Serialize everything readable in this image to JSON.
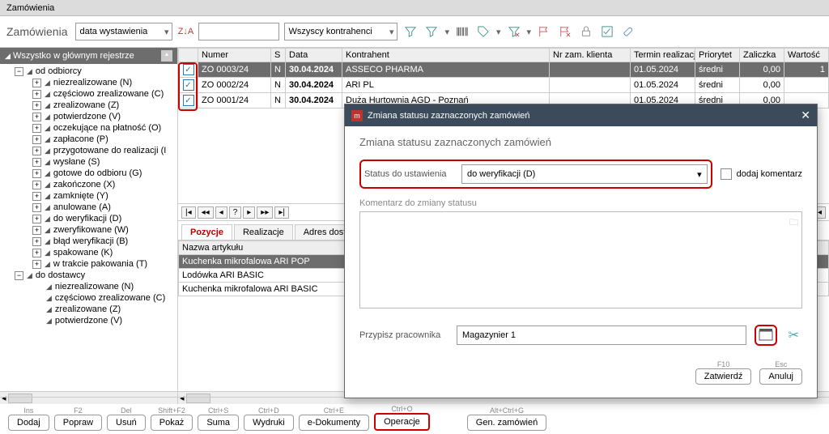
{
  "titlebar": "Zamówienia",
  "top": {
    "title": "Zamówienia",
    "dateCombo": "data wystawienia",
    "kontrahenciCombo": "Wszyscy kontrahenci"
  },
  "treeHeader": "Wszystko w głównym rejestrze",
  "tree": {
    "root1": "od odbiorcy",
    "items1": [
      "niezrealizowane (N)",
      "częściowo zrealizowane (C)",
      "zrealizowane (Z)",
      "potwierdzone (V)",
      "oczekujące na płatność (O)",
      "zapłacone (P)",
      "przygotowane do realizacji (I",
      "wysłane (S)",
      "gotowe do odbioru (G)",
      "zakończone (X)",
      "zamknięte (Y)",
      "anulowane  (A)",
      "do weryfikacji (D)",
      "zweryfikowane (W)",
      "błąd weryfikacji (B)",
      "spakowane (K)",
      "w trakcie pakowania (T)"
    ],
    "root2": "do dostawcy",
    "items2": [
      "niezrealizowane (N)",
      "częściowo zrealizowane (C)",
      "zrealizowane (Z)",
      "potwierdzone (V)"
    ]
  },
  "gridHeaders": [
    "",
    "Numer",
    "S",
    "Data",
    "Kontrahent",
    "Nr zam. klienta",
    "Termin realizacji",
    "Priorytet",
    "Zaliczka",
    "Wartość"
  ],
  "rows": [
    {
      "num": "ZO 0003/24",
      "s": "N",
      "date": "30.04.2024",
      "k": "ASSECO PHARMA",
      "nz": "",
      "term": "01.05.2024",
      "prio": "średni",
      "zal": "0,00",
      "wart": "1"
    },
    {
      "num": "ZO 0002/24",
      "s": "N",
      "date": "30.04.2024",
      "k": "ARI PL",
      "nz": "",
      "term": "01.05.2024",
      "prio": "średni",
      "zal": "0,00",
      "wart": ""
    },
    {
      "num": "ZO 0001/24",
      "s": "N",
      "date": "30.04.2024",
      "k": "Duża Hurtownia AGD - Poznań",
      "nz": "",
      "term": "01.05.2024",
      "prio": "średni",
      "zal": "0,00",
      "wart": ""
    }
  ],
  "tabs": {
    "pozycje": "Pozycje",
    "realizacje": "Realizacje",
    "adres": "Adres dostawy"
  },
  "detailHeader": "Nazwa artykułu",
  "detailRows": [
    "Kuchenka mikrofalowa ARI POP",
    "Lodówka ARI BASIC",
    "Kuchenka mikrofalowa ARI BASIC"
  ],
  "modal": {
    "title": "Zmiana statusu zaznaczonych zamówień",
    "heading": "Zmiana statusu zaznaczonych zamówień",
    "statusLabel": "Status do ustawienia",
    "statusValue": "do weryfikacji (D)",
    "commentCheck": "dodaj komentarz",
    "commentLabel": "Komentarz do zmiany statusu",
    "assignLabel": "Przypisz pracownika",
    "assignValue": "Magazynier 1",
    "ok": {
      "hint": "F10",
      "label": "Zatwierdź"
    },
    "cancel": {
      "hint": "Esc",
      "label": "Anuluj"
    }
  },
  "bottom": [
    {
      "hint": "Ins",
      "label": "Dodaj"
    },
    {
      "hint": "F2",
      "label": "Popraw"
    },
    {
      "hint": "Del",
      "label": "Usuń"
    },
    {
      "hint": "Shift+F2",
      "label": "Pokaż"
    },
    {
      "hint": "Ctrl+S",
      "label": "Suma"
    },
    {
      "hint": "Ctrl+D",
      "label": "Wydruki"
    },
    {
      "hint": "Ctrl+E",
      "label": "e-Dokumenty"
    },
    {
      "hint": "Ctrl+O",
      "label": "Operacje",
      "hl": true
    },
    {
      "hint": "Alt+Ctrl+G",
      "label": "Gen. zamówień"
    }
  ]
}
